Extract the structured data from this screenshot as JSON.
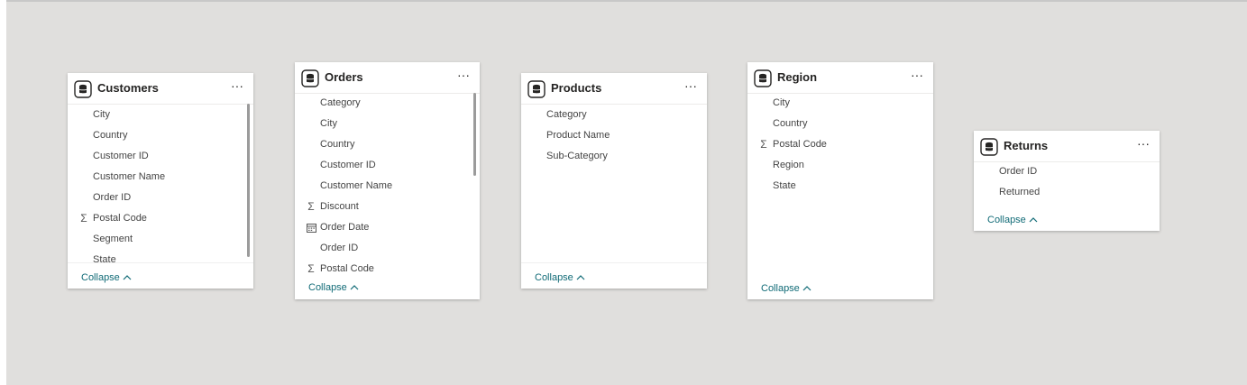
{
  "colors": {
    "canvas": "#e0dfdd",
    "card": "#ffffff",
    "collapse_link": "#116b77",
    "title": "#252423"
  },
  "icons": {
    "table": "database-table-icon",
    "sum": "sigma-icon",
    "date": "calendar-icon",
    "more": "ellipsis-icon",
    "collapse": "chevron-up-icon"
  },
  "more_label": "···",
  "collapse_label": "Collapse",
  "tables": [
    {
      "title": "Customers",
      "fields": [
        {
          "label": "City",
          "icon": ""
        },
        {
          "label": "Country",
          "icon": ""
        },
        {
          "label": "Customer ID",
          "icon": ""
        },
        {
          "label": "Customer Name",
          "icon": ""
        },
        {
          "label": "Order ID",
          "icon": ""
        },
        {
          "label": "Postal Code",
          "icon": "sigma"
        },
        {
          "label": "Segment",
          "icon": ""
        },
        {
          "label": "State",
          "icon": ""
        }
      ]
    },
    {
      "title": "Orders",
      "fields": [
        {
          "label": "Category",
          "icon": ""
        },
        {
          "label": "City",
          "icon": ""
        },
        {
          "label": "Country",
          "icon": ""
        },
        {
          "label": "Customer ID",
          "icon": ""
        },
        {
          "label": "Customer Name",
          "icon": ""
        },
        {
          "label": "Discount",
          "icon": "sigma"
        },
        {
          "label": "Order Date",
          "icon": "calendar"
        },
        {
          "label": "Order ID",
          "icon": ""
        },
        {
          "label": "Postal Code",
          "icon": "sigma"
        }
      ]
    },
    {
      "title": "Products",
      "fields": [
        {
          "label": "Category",
          "icon": ""
        },
        {
          "label": "Product Name",
          "icon": ""
        },
        {
          "label": "Sub-Category",
          "icon": ""
        }
      ]
    },
    {
      "title": "Region",
      "fields": [
        {
          "label": "City",
          "icon": ""
        },
        {
          "label": "Country",
          "icon": ""
        },
        {
          "label": "Postal Code",
          "icon": "sigma"
        },
        {
          "label": "Region",
          "icon": ""
        },
        {
          "label": "State",
          "icon": ""
        }
      ]
    },
    {
      "title": "Returns",
      "fields": [
        {
          "label": "Order ID",
          "icon": ""
        },
        {
          "label": "Returned",
          "icon": ""
        }
      ]
    }
  ]
}
